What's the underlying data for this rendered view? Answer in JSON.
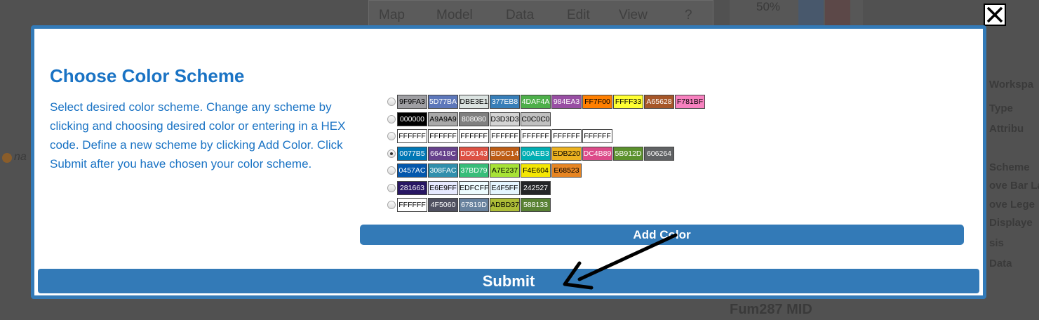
{
  "background": {
    "menus": [
      "Map",
      "Model",
      "Data",
      "Edit",
      "View",
      "?"
    ],
    "right_items": [
      "Workspa",
      "Type",
      "Attribu",
      "Scheme",
      "ove Bar La",
      "ove Lege",
      "Displaye",
      "sis",
      "Data"
    ],
    "bottom_text": "Fum287 MID",
    "left_text": "na",
    "chart_label": "50%"
  },
  "close_icon": "close-icon",
  "modal": {
    "title": "Choose Color Scheme",
    "description": "Select desired color scheme. Change any scheme by clicking and choosing desired color or entering in a HEX code. Define a new scheme by clicking Add Color. Click Submit after you have chosen your color scheme.",
    "add_color_label": "Add Color",
    "submit_label": "Submit",
    "selected_scheme": 3
  },
  "schemes": [
    [
      "9F9FA3",
      "5D77BA",
      "DBE3E1",
      "377EB8",
      "4DAF4A",
      "984EA3",
      "FF7F00",
      "FFFF33",
      "A65628",
      "F781BF"
    ],
    [
      "000000",
      "A9A9A9",
      "808080",
      "D3D3D3",
      "C0C0C0"
    ],
    [
      "FFFFFF",
      "FFFFFF",
      "FFFFFF",
      "FFFFFF",
      "FFFFFF",
      "FFFFFF",
      "FFFFFF"
    ],
    [
      "0077B5",
      "66418C",
      "DD5143",
      "BD5C14",
      "00AEB3",
      "EDB220",
      "DC4B89",
      "5B912D",
      "606264"
    ],
    [
      "0457AC",
      "308FAC",
      "37BD79",
      "A7E237",
      "F4E604",
      "E68523"
    ],
    [
      "281663",
      "E6E9FF",
      "EDFCFF",
      "E4F5FF",
      "242527"
    ],
    [
      "FFFFFF",
      "4F5060",
      "67819D",
      "ADBD37",
      "588133"
    ]
  ]
}
